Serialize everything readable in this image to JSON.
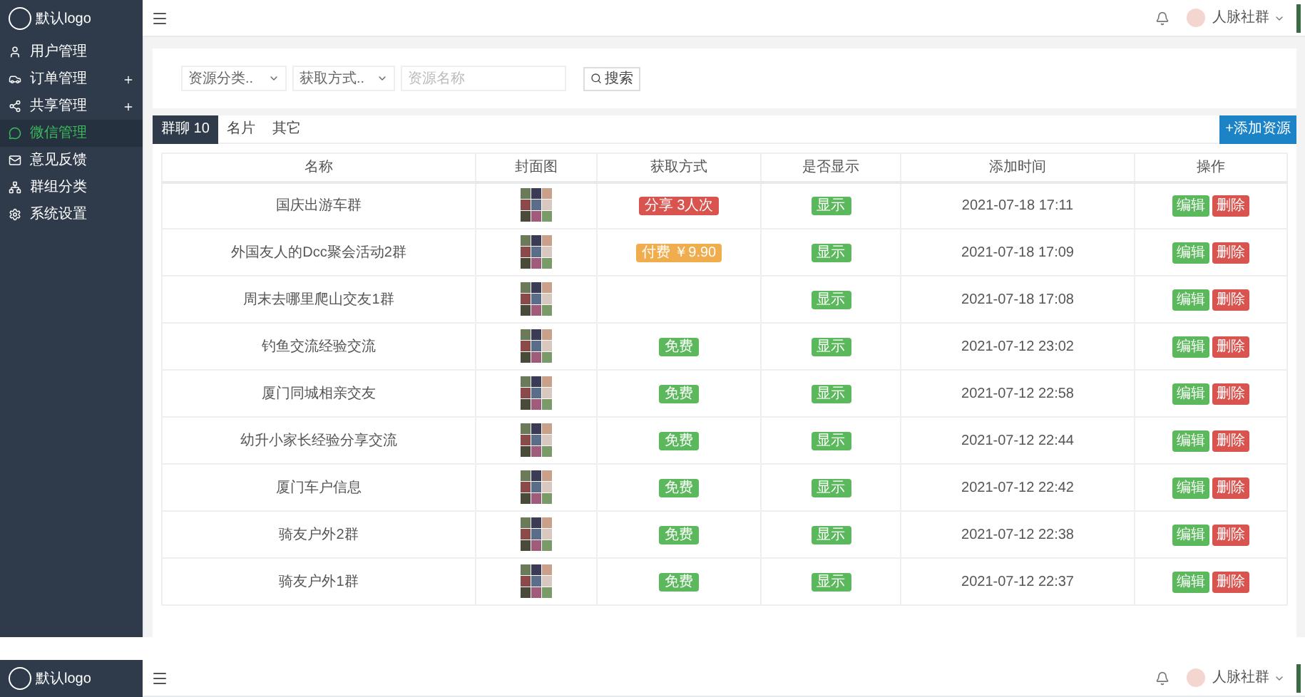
{
  "brand": "默认logo",
  "sidebar": {
    "items": [
      {
        "label": "用户管理",
        "expandable": false,
        "selected": false
      },
      {
        "label": "订单管理",
        "expandable": true,
        "selected": false
      },
      {
        "label": "共享管理",
        "expandable": true,
        "selected": false
      },
      {
        "label": "微信管理",
        "expandable": false,
        "selected": true
      },
      {
        "label": "意见反馈",
        "expandable": false,
        "selected": false
      },
      {
        "label": "群组分类",
        "expandable": false,
        "selected": false
      },
      {
        "label": "系统设置",
        "expandable": false,
        "selected": false
      }
    ]
  },
  "header": {
    "user": "人脉社群"
  },
  "filters": {
    "category": "资源分类..",
    "method": "获取方式..",
    "search": {
      "placeholder": "资源名称"
    },
    "search_button": "搜索"
  },
  "tabs": [
    {
      "label": "群聊 10",
      "selected": true
    },
    {
      "label": "名片",
      "selected": false
    },
    {
      "label": "其它",
      "selected": false
    }
  ],
  "add_button": "+添加资源",
  "table": {
    "columns": [
      "名称",
      "封面图",
      "获取方式",
      "是否显示",
      "添加时间",
      "操作"
    ],
    "rows": [
      {
        "name": "国庆出游车群",
        "method": {
          "kind": "share",
          "label": "分享 3人次"
        },
        "visible": "显示",
        "time": "2021-07-18 17:11",
        "edit": "编辑",
        "delete": "删除"
      },
      {
        "name": "外国友人的Dcc聚会活动2群",
        "method": {
          "kind": "paid",
          "label": "付费 ￥9.90"
        },
        "visible": "显示",
        "time": "2021-07-18 17:09",
        "edit": "编辑",
        "delete": "删除"
      },
      {
        "name": "周末去哪里爬山交友1群",
        "visible": "显示",
        "time": "2021-07-18 17:08",
        "edit": "编辑",
        "delete": "删除"
      },
      {
        "name": "钓鱼交流经验交流",
        "method": {
          "kind": "free",
          "label": "免费"
        },
        "visible": "显示",
        "time": "2021-07-12 23:02",
        "edit": "编辑",
        "delete": "删除"
      },
      {
        "name": "厦门同城相亲交友",
        "method": {
          "kind": "free",
          "label": "免费"
        },
        "visible": "显示",
        "time": "2021-07-12 22:58",
        "edit": "编辑",
        "delete": "删除"
      },
      {
        "name": "幼升小家长经验分享交流",
        "method": {
          "kind": "free",
          "label": "免费"
        },
        "visible": "显示",
        "time": "2021-07-12 22:44",
        "edit": "编辑",
        "delete": "删除"
      },
      {
        "name": "厦门车户信息",
        "method": {
          "kind": "free",
          "label": "免费"
        },
        "visible": "显示",
        "time": "2021-07-12 22:42",
        "edit": "编辑",
        "delete": "删除"
      },
      {
        "name": "骑友户外2群",
        "method": {
          "kind": "free",
          "label": "免费"
        },
        "visible": "显示",
        "time": "2021-07-12 22:38",
        "edit": "编辑",
        "delete": "删除"
      },
      {
        "name": "骑友户外1群",
        "method": {
          "kind": "free",
          "label": "免费"
        },
        "visible": "显示",
        "time": "2021-07-12 22:37",
        "edit": "编辑",
        "delete": "删除"
      }
    ]
  },
  "header_repeat": {
    "brand": "默认logo",
    "user": "人脉社群"
  }
}
